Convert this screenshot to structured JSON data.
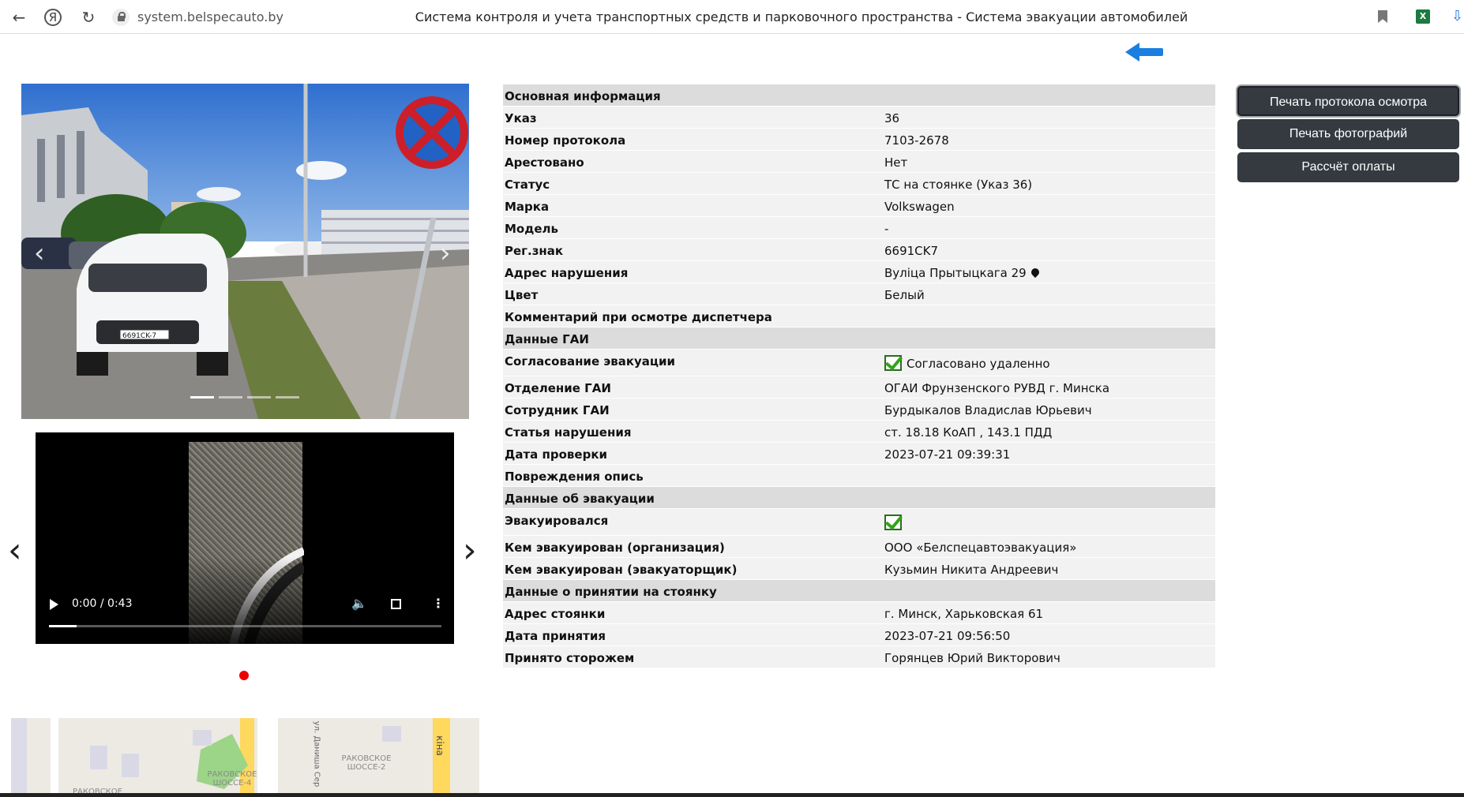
{
  "browser": {
    "url": "system.belspecauto.by",
    "tab_title": "Система контроля и учета транспортных средств и парковочного пространства - Система эвакуации автомобилей",
    "excel_icon_text": "X"
  },
  "video": {
    "time": "0:00 / 0:43",
    "progress_fraction": 0.07
  },
  "photo": {
    "plate_text": "6691CK-7",
    "indicator_count": 4
  },
  "map": {
    "labels": [
      "РАКОВСКОЕ ШОССЕ-4",
      "РАКОВСКОЕ ШОССЕ-2",
      "РАКОВСКОЕ",
      "кіна",
      "ул. Даниша Сер"
    ]
  },
  "info": {
    "sections": {
      "main": "Основная информация",
      "gai": "Данные ГАИ",
      "evac": "Данные об эвакуации",
      "parking": "Данные о принятии на стоянку"
    },
    "rows": {
      "ukaz": {
        "label": "Указ",
        "value": "36"
      },
      "protocol": {
        "label": "Номер протокола",
        "value": "7103-2678"
      },
      "arrested": {
        "label": "Арестовано",
        "value": "Нет"
      },
      "status": {
        "label": "Статус",
        "value": "ТС на стоянке (Указ 36)"
      },
      "brand": {
        "label": "Марка",
        "value": "Volkswagen"
      },
      "model": {
        "label": "Модель",
        "value": "-"
      },
      "plate": {
        "label": "Рег.знак",
        "value": "6691CK7"
      },
      "address": {
        "label": "Адрес нарушения",
        "value": "Вуліца Прытыцкага 29"
      },
      "color": {
        "label": "Цвет",
        "value": "Белый"
      },
      "comment": {
        "label": "Комментарий при осмотре диспетчера",
        "value": ""
      },
      "agreement": {
        "label": "Согласование эвакуации",
        "value": "Согласовано удаленно"
      },
      "department": {
        "label": "Отделение ГАИ",
        "value": "ОГАИ Фрунзенского РУВД г. Минска"
      },
      "officer": {
        "label": "Сотрудник ГАИ",
        "value": "Бурдыкалов Владислав Юрьевич"
      },
      "article": {
        "label": "Статья нарушения",
        "value": "ст. 18.18 КоАП , 143.1 ПДД"
      },
      "check_date": {
        "label": "Дата проверки",
        "value": "2023-07-21 09:39:31"
      },
      "damage": {
        "label": "Повреждения опись",
        "value": ""
      },
      "evacuated": {
        "label": "Эвакуировался",
        "value": ""
      },
      "evac_org": {
        "label": "Кем эвакуирован (организация)",
        "value": "ООО «Белспецавтоэвакуация»"
      },
      "evac_driver": {
        "label": "Кем эвакуирован (эвакуаторщик)",
        "value": "Кузьмин Никита Андреевич"
      },
      "lot_address": {
        "label": "Адрес стоянки",
        "value": "г. Минск, Харьковская 61"
      },
      "accept_date": {
        "label": "Дата принятия",
        "value": "2023-07-21 09:56:50"
      },
      "guard": {
        "label": "Принято сторожем",
        "value": "Горянцев Юрий Викторович"
      }
    }
  },
  "actions": {
    "print_protocol": "Печать протокола осмотра",
    "print_photos": "Печать фотографий",
    "calc_payment": "Рассчёт оплаты"
  }
}
